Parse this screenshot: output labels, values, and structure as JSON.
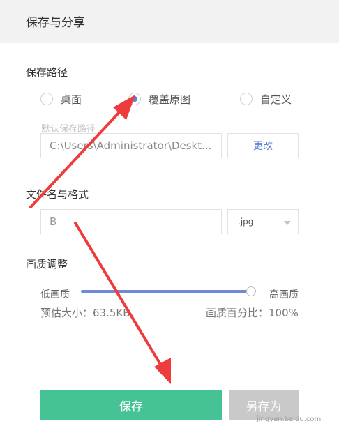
{
  "dialog": {
    "title": "保存与分享"
  },
  "save_path": {
    "label": "保存路径",
    "options": [
      {
        "label": "桌面",
        "selected": false
      },
      {
        "label": "覆盖原图",
        "selected": true
      },
      {
        "label": "自定义",
        "selected": false
      }
    ],
    "default_hint": "默认保存路径",
    "path_value": "C:\\Users\\Administrator\\Deskt...",
    "change_button": "更改"
  },
  "filename": {
    "label": "文件名与格式",
    "value": "B",
    "format": ".jpg"
  },
  "quality": {
    "label": "画质调整",
    "low_label": "低画质",
    "high_label": "高画质",
    "level_percent": 100,
    "estimate": "预估大小：63.5KB",
    "percent_text": "画质百分比：100%"
  },
  "actions": {
    "save": "保存",
    "save_as": "另存为"
  },
  "watermark": "jingyan.baidu.com",
  "colors": {
    "accent": "#5a7fd6",
    "primary_button": "#45c394",
    "annotation_arrow": "#ee3b3b"
  }
}
